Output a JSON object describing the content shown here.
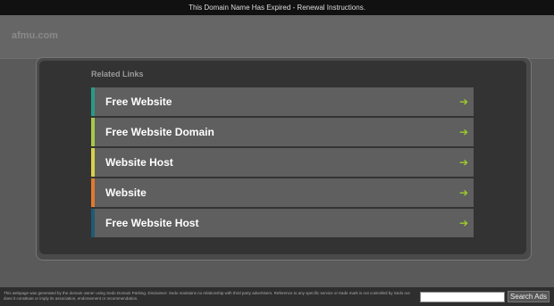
{
  "topbar": {
    "text": "This Domain Name Has Expired - Renewal Instructions."
  },
  "site": {
    "domain": "afmu.com"
  },
  "related": {
    "heading": "Related Links",
    "items": [
      {
        "label": "Free Website",
        "accent": "#2a9a88",
        "arrow": "➔"
      },
      {
        "label": "Free Website Domain",
        "accent": "#a8c94a",
        "arrow": "➔"
      },
      {
        "label": "Website Host",
        "accent": "#d7d14a",
        "arrow": "➔"
      },
      {
        "label": "Website",
        "accent": "#e07a2d",
        "arrow": "➔"
      },
      {
        "label": "Free Website Host",
        "accent": "#1f5a74",
        "arrow": "➔"
      }
    ]
  },
  "footer": {
    "disclaimer": "This webpage was generated by the domain owner using Sedo Domain Parking. Disclaimer: Sedo maintains no relationship with third party advertisers. Reference to any specific service or trade mark is not controlled by Sedo nor does it constitute or imply its association, endorsement or recommendation.",
    "search_button": "Search Ads",
    "search_value": ""
  }
}
